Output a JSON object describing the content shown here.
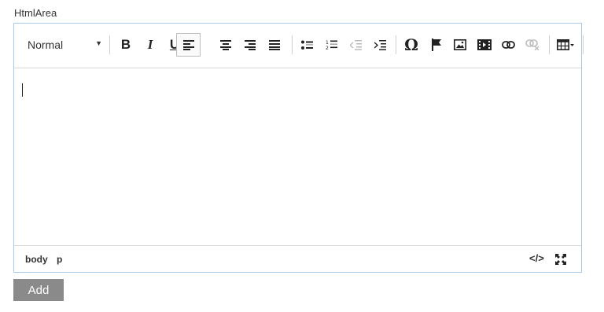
{
  "field": {
    "label": "HtmlArea"
  },
  "toolbar": {
    "format_value": "Normal",
    "bold_label": "B",
    "italic_label": "I",
    "underline_label": "U",
    "special_char_label": "Ω",
    "icons": [
      "bold-icon",
      "italic-icon",
      "underline-icon",
      "align-left-icon",
      "align-center-icon",
      "align-right-icon",
      "align-justify-icon",
      "bullet-list-icon",
      "numbered-list-icon",
      "outdent-icon",
      "indent-icon",
      "special-character-icon",
      "anchor-flag-icon",
      "image-icon",
      "video-icon",
      "link-icon",
      "unlink-icon",
      "table-icon"
    ]
  },
  "statusbar": {
    "path": [
      "body",
      "p"
    ],
    "source_label": "</>",
    "icons": [
      "source-code-icon",
      "fullscreen-icon"
    ]
  },
  "actions": {
    "add_label": "Add"
  },
  "colors": {
    "editor_border": "#a9cbe8",
    "add_button_bg": "#8a8a8a",
    "separator": "#cfcfcf"
  }
}
